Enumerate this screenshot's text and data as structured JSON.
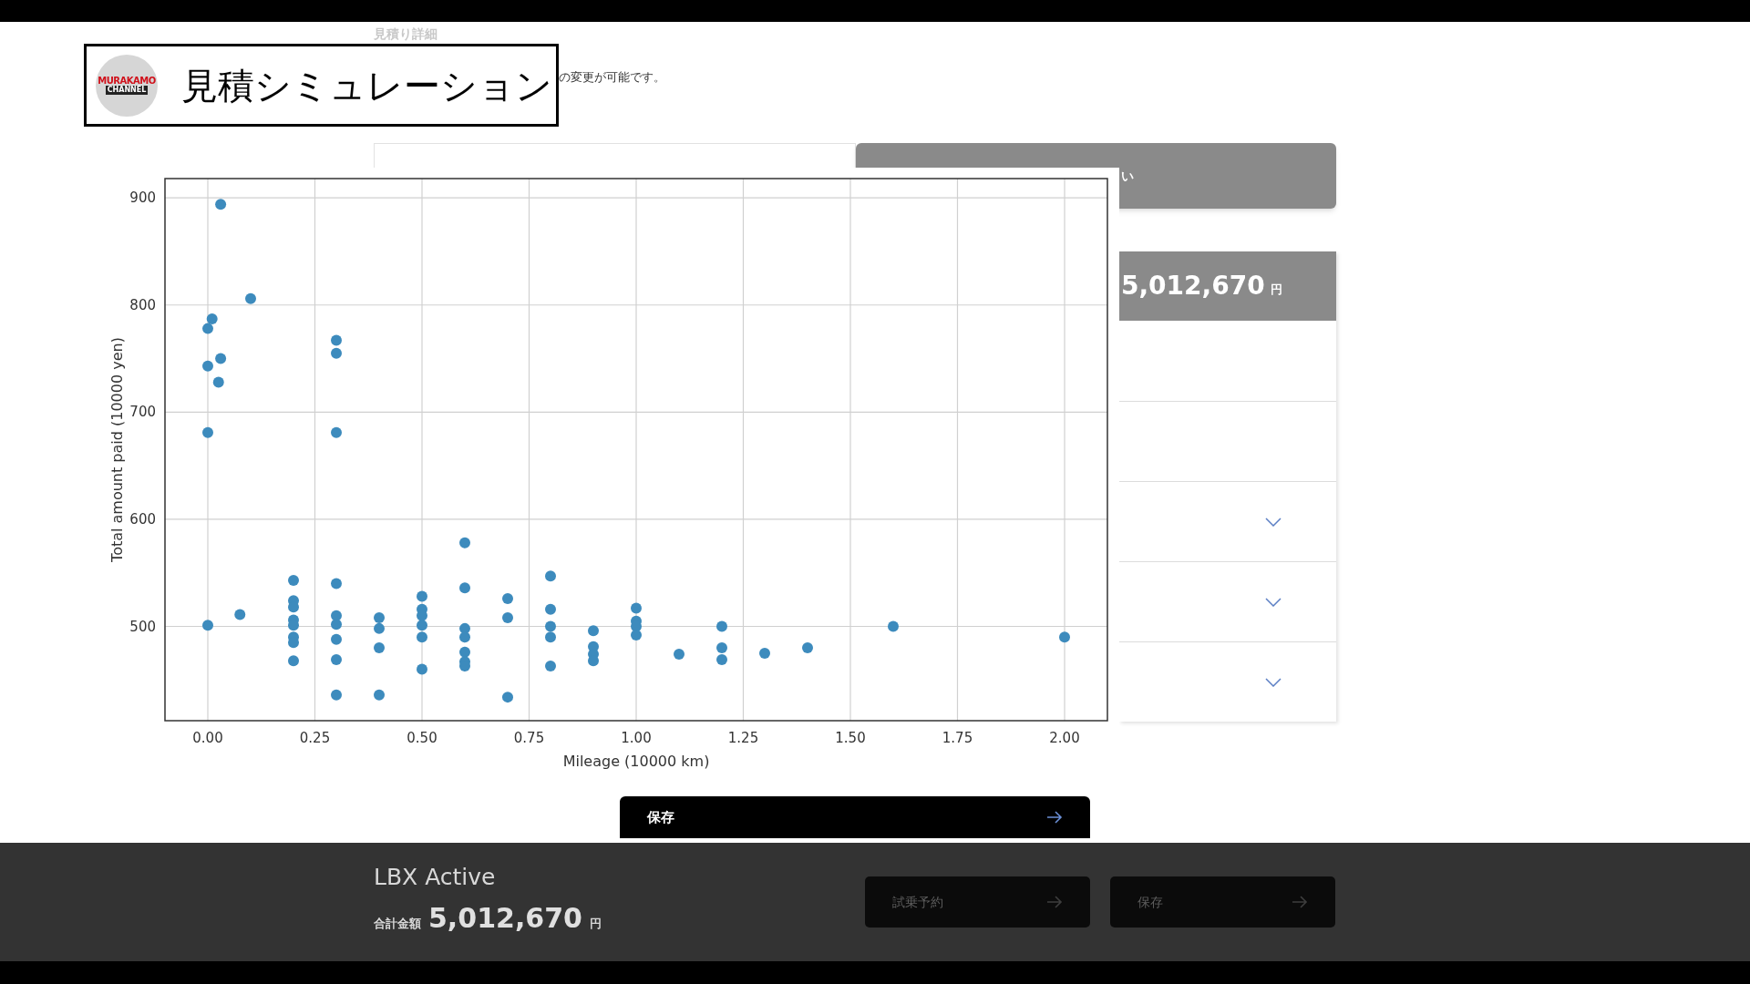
{
  "header": {
    "title": "見積シミュレーション",
    "logo": {
      "lines": [
        "MURAKAMO",
        "CHANNEL"
      ]
    }
  },
  "page": {
    "heading": "見積り詳細",
    "description": "の変更が可能です。"
  },
  "panel": {
    "tab_label": "い",
    "total": {
      "amount": "5,012,670",
      "unit": "円"
    },
    "rows": [
      {
        "kind": "blank"
      },
      {
        "kind": "blank"
      },
      {
        "kind": "dropdown",
        "expanded": false
      },
      {
        "kind": "dropdown",
        "expanded": false
      },
      {
        "kind": "dropdown",
        "expanded": false
      }
    ]
  },
  "chart": {
    "chart_data": {
      "type": "scatter",
      "grid": true,
      "xlabel": "Mileage (10000 km)",
      "ylabel": "Total amount paid (10000 yen)",
      "xlim": [
        -0.1,
        2.1
      ],
      "ylim": [
        412,
        918
      ],
      "xticks": [
        {
          "value": 0,
          "label": "0.00"
        },
        {
          "value": 0.25,
          "label": "0.25"
        },
        {
          "value": 0.5,
          "label": "0.50"
        },
        {
          "value": 0.75,
          "label": "0.75"
        },
        {
          "value": 1,
          "label": "1.00"
        },
        {
          "value": 1.25,
          "label": "1.25"
        },
        {
          "value": 1.5,
          "label": "1.50"
        },
        {
          "value": 1.75,
          "label": "1.75"
        },
        {
          "value": 2,
          "label": "2.00"
        }
      ],
      "yticks": [
        500,
        600,
        700,
        800,
        900
      ],
      "x": [
        0.03,
        0.1,
        0.01,
        0,
        0.03,
        0,
        0.025,
        0,
        0,
        0.075,
        0.2,
        0.2,
        0.2,
        0.2,
        0.2,
        0.2,
        0.2,
        0.2,
        0.3,
        0.3,
        0.3,
        0.3,
        0.3,
        0.3,
        0.3,
        0.3,
        0.3,
        0.4,
        0.4,
        0.4,
        0.4,
        0.5,
        0.5,
        0.5,
        0.5,
        0.5,
        0.5,
        0.6,
        0.6,
        0.6,
        0.6,
        0.6,
        0.6,
        0.6,
        0.7,
        0.7,
        0.7,
        0.8,
        0.8,
        0.8,
        0.8,
        0.8,
        0.9,
        0.9,
        0.9,
        0.9,
        1.0,
        1.0,
        1.0,
        1.0,
        1.1,
        1.2,
        1.2,
        1.2,
        1.3,
        1.4,
        1.6,
        2.0
      ],
      "series": [
        {
          "color": "#3d8bbd",
          "values": [
            894,
            806,
            787,
            778,
            750,
            743,
            728,
            681,
            501,
            511,
            543,
            524,
            518,
            506,
            501,
            490,
            485,
            468,
            767,
            755,
            681,
            540,
            510,
            502,
            488,
            469,
            436,
            508,
            498,
            480,
            436,
            528,
            516,
            510,
            501,
            490,
            460,
            578,
            536,
            498,
            490,
            476,
            467,
            463,
            526,
            508,
            434,
            547,
            516,
            500,
            490,
            463,
            496,
            481,
            474,
            468,
            517,
            505,
            500,
            492,
            474,
            500,
            480,
            469,
            475,
            480,
            500,
            490
          ]
        }
      ]
    }
  },
  "save_button": {
    "label": "保存"
  },
  "footer": {
    "model": "LBX Active",
    "total_label": "合計金額",
    "total": "5,012,670",
    "unit": "円",
    "buttons": [
      {
        "label": "試乗予約",
        "disabled": true
      },
      {
        "label": "保存",
        "disabled": true
      }
    ]
  }
}
